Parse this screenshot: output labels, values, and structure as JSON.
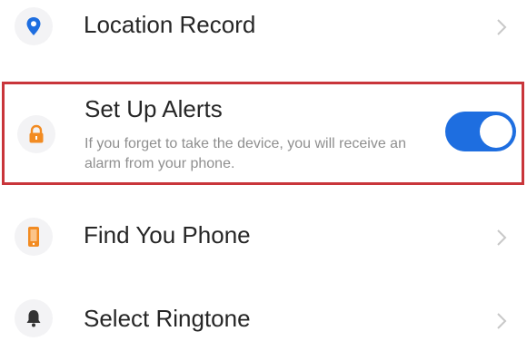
{
  "colors": {
    "accent_blue": "#1e6ee0",
    "accent_orange": "#f28b22",
    "highlight_red": "#c9353a",
    "icon_dark": "#333333",
    "chevron": "#c8c8c8"
  },
  "menu": {
    "location_record": {
      "label": "Location Record",
      "icon": "location-pin-icon"
    },
    "set_up_alerts": {
      "label": "Set Up Alerts",
      "description": "If you forget to take the device, you will receive an alarm from your phone.",
      "icon": "lock-icon",
      "toggle_on": true
    },
    "find_phone": {
      "label": "Find You Phone",
      "icon": "phone-icon"
    },
    "select_ringtone": {
      "label": "Select Ringtone",
      "icon": "bell-icon"
    }
  }
}
